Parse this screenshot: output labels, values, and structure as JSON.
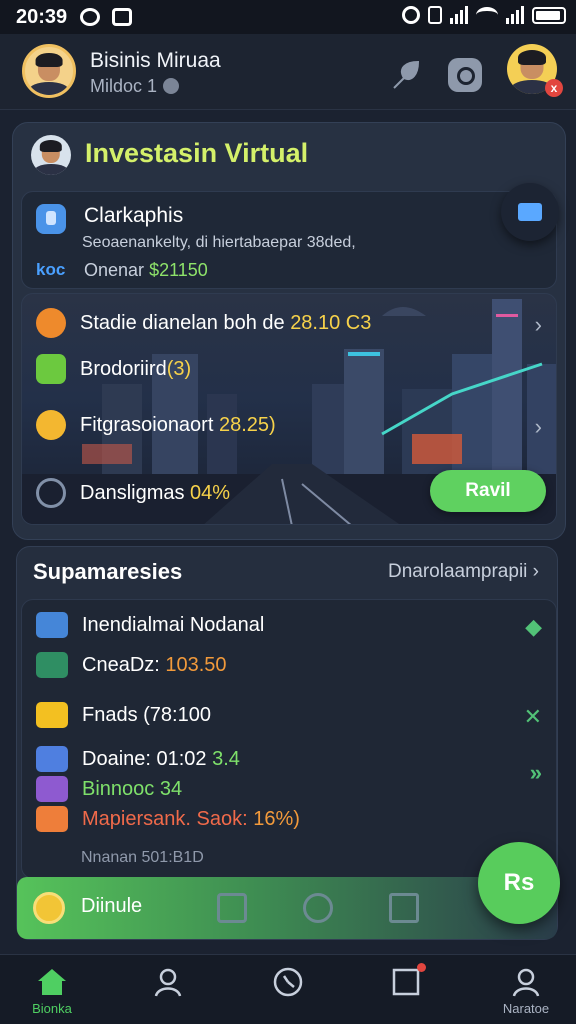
{
  "status": {
    "time": "20:39"
  },
  "header": {
    "name": "Bisinis Miruaa",
    "subtitle": "Mildoc 1",
    "notification_badge": "x"
  },
  "invest": {
    "title": "Investasin Virtual",
    "card": {
      "title": "Clarkaphis",
      "desc": "Seoaenankelty, di hiertabaepar 38ded,",
      "tag": "koc",
      "amount_label": "Onenar",
      "amount_value": "$21150"
    },
    "rows": [
      {
        "icon": "check-icon",
        "text": "Stadie dianelan boh de ",
        "highlight": "28.10 C3"
      },
      {
        "icon": "board-icon",
        "text": "Brodoriird",
        "highlight": "(3)"
      },
      {
        "icon": "check-icon",
        "text": "Fitgrasoionaort ",
        "highlight": "28.25)"
      },
      {
        "icon": "spinner-icon",
        "text": "Dansligmas ",
        "highlight": "04%"
      }
    ],
    "button": "Ravil"
  },
  "summary": {
    "title": "Supamaresies",
    "link": "Dnarolaamprapii",
    "items": [
      {
        "text": "Inendialmai Nodanal",
        "value": ""
      },
      {
        "text": "CneaDz: ",
        "value": "103.50"
      },
      {
        "text": "Fnads (78:100",
        "value": ""
      },
      {
        "text": "Doaine: 01:02 ",
        "value": "3.4"
      },
      {
        "text": "Binnooc ",
        "value": "34"
      },
      {
        "text": "Mapiersank. Saok: ",
        "value": "16%)"
      }
    ],
    "footer": "Nnanan 501:B1D",
    "bar_label": "Diinule"
  },
  "fab": "Rs",
  "nav": [
    {
      "label": "Bionka"
    },
    {
      "label": ""
    },
    {
      "label": ""
    },
    {
      "label": ""
    },
    {
      "label": "Naratoe"
    }
  ],
  "colors": {
    "accent_green": "#5fd160",
    "title_lime": "#d4f06a",
    "highlight_yellow": "#f7d24a",
    "bg": "#1b2230"
  }
}
